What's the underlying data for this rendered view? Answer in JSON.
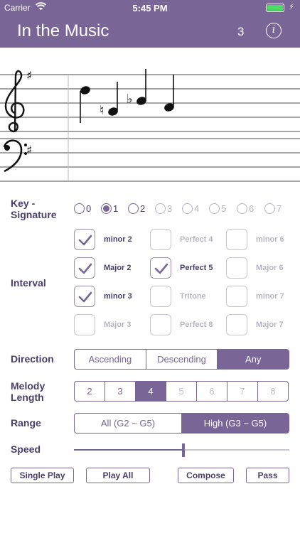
{
  "status_bar": {
    "carrier": "Carrier",
    "time": "5:45 PM"
  },
  "nav": {
    "title": "In the Music",
    "count": "3",
    "info_glyph": "i"
  },
  "colors": {
    "accent": "#7a6597",
    "text": "#4a3f6b",
    "disabled": "#b8b4c2"
  },
  "key_signature": {
    "label": "Key -\nSignature",
    "options": [
      {
        "label": "0",
        "state": "normal"
      },
      {
        "label": "1",
        "state": "selected"
      },
      {
        "label": "2",
        "state": "normal"
      },
      {
        "label": "3",
        "state": "disabled"
      },
      {
        "label": "4",
        "state": "disabled"
      },
      {
        "label": "5",
        "state": "disabled"
      },
      {
        "label": "6",
        "state": "disabled"
      },
      {
        "label": "7",
        "state": "disabled"
      }
    ]
  },
  "interval": {
    "label": "Interval",
    "options": [
      {
        "label": "minor 2",
        "checked": true,
        "enabled": true
      },
      {
        "label": "Perfect 4",
        "checked": false,
        "enabled": false
      },
      {
        "label": "minor 6",
        "checked": false,
        "enabled": false
      },
      {
        "label": "Major 2",
        "checked": true,
        "enabled": true
      },
      {
        "label": "Perfect 5",
        "checked": true,
        "enabled": true
      },
      {
        "label": "Major 6",
        "checked": false,
        "enabled": false
      },
      {
        "label": "minor 3",
        "checked": true,
        "enabled": true
      },
      {
        "label": "Tritone",
        "checked": false,
        "enabled": false
      },
      {
        "label": "minor 7",
        "checked": false,
        "enabled": false
      },
      {
        "label": "Major 3",
        "checked": false,
        "enabled": false
      },
      {
        "label": "Perfect 8",
        "checked": false,
        "enabled": false
      },
      {
        "label": "Major 7",
        "checked": false,
        "enabled": false
      }
    ]
  },
  "direction": {
    "label": "Direction",
    "options": [
      "Ascending",
      "Descending",
      "Any"
    ],
    "selected": 2
  },
  "melody_length": {
    "label": "Melody\nLength",
    "options": [
      "2",
      "3",
      "4",
      "5",
      "6",
      "7",
      "8"
    ],
    "selected": 2,
    "max_enabled": 2
  },
  "range": {
    "label": "Range",
    "options": [
      "All (G2 ~ G5)",
      "High (G3 ~ G5)"
    ],
    "selected": 1
  },
  "speed": {
    "label": "Speed",
    "value": 0.5
  },
  "buttons": {
    "single_play": "Single Play",
    "play_all": "Play All",
    "compose": "Compose",
    "pass": "Pass"
  }
}
